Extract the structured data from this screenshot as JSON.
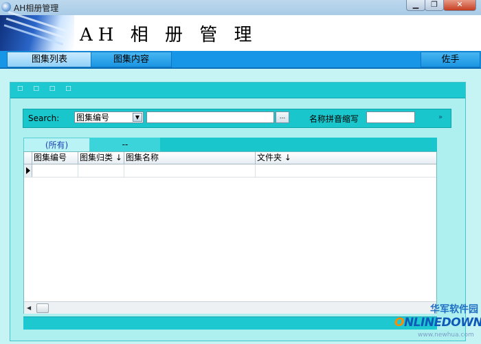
{
  "window": {
    "title": "AH相册管理",
    "controls": {
      "minimize": "▁",
      "maximize": "❐",
      "close": "✕"
    }
  },
  "banner": {
    "title": "AH 相 册 管 理"
  },
  "nav": {
    "tabs": [
      {
        "label": "图集列表",
        "active": true
      },
      {
        "label": "图集内容",
        "active": false
      }
    ],
    "assistant_label": "佐手"
  },
  "panel": {
    "header_glyphs": "□ □ □ □"
  },
  "search": {
    "label": "Search:",
    "field_selected": "图集编号",
    "query_value": "",
    "browse_label": "...",
    "pinyin_label": "名称拼音缩写",
    "pinyin_value": "",
    "more_label": "»"
  },
  "grid": {
    "filter_tabs": [
      {
        "label": "(所有)",
        "active": true
      },
      {
        "label": "--",
        "active": false
      }
    ],
    "columns": [
      "图集编号",
      "图集归类 ↓",
      "图集名称",
      "文件夹 ↓"
    ],
    "rows": []
  },
  "watermark": {
    "cn": "华军软件园",
    "logo_prefix": "O",
    "logo_rest": "NLINEDOWN",
    "url": "www.newhua.com"
  },
  "colors": {
    "accent": "#1ec8d0",
    "tab_bar": "#1795e6",
    "panel_bg": "#aef0f0"
  },
  "icons": [
    "app-icon",
    "dropdown-arrow-icon",
    "row-indicator-icon",
    "scroll-left-icon"
  ]
}
